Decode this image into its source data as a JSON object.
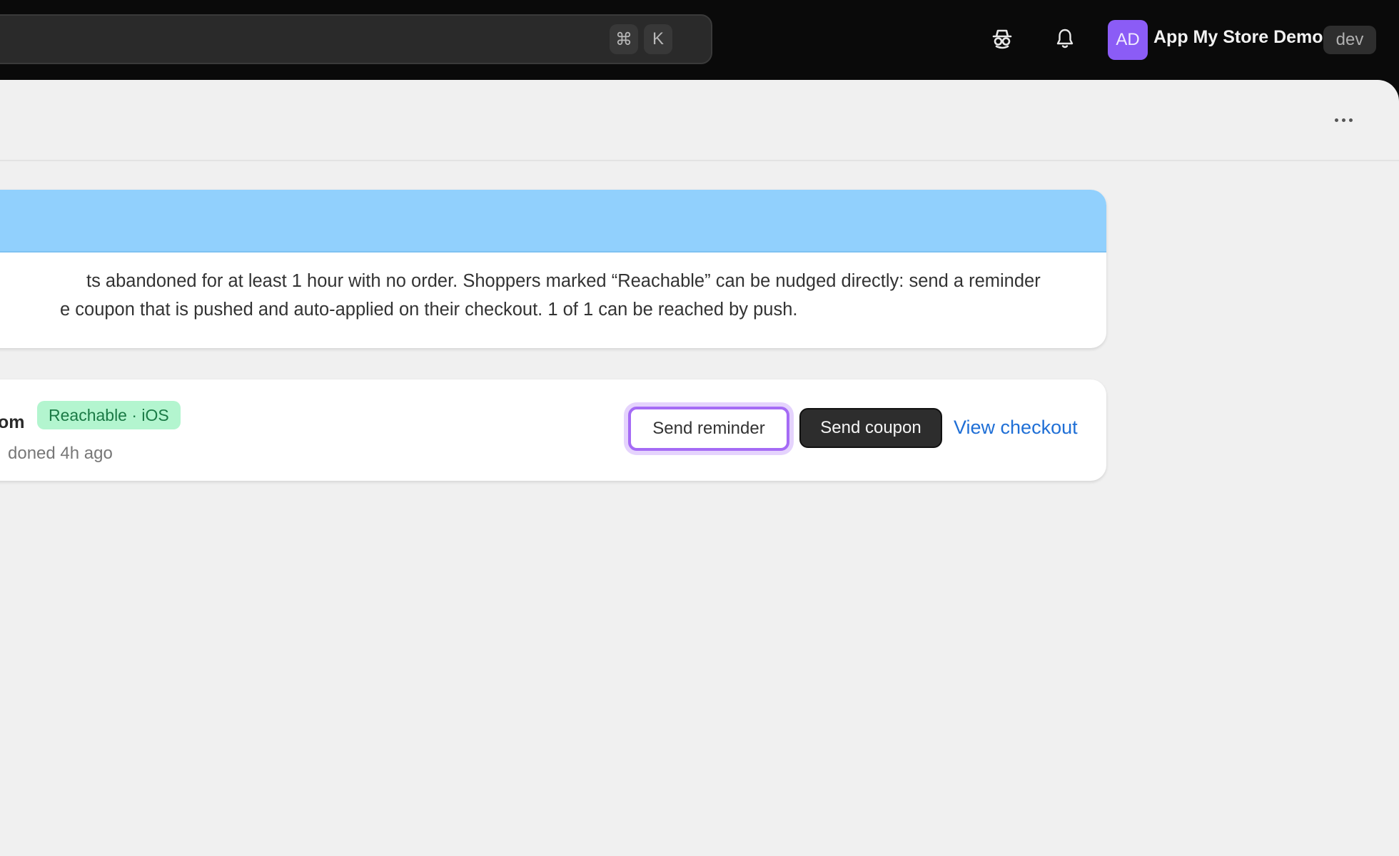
{
  "topbar": {
    "search": {
      "shortcut_mod": "⌘",
      "shortcut_key": "K"
    },
    "icons": {
      "incognito": "incognito-icon",
      "notifications": "bell-icon"
    },
    "avatar_initials": "AD",
    "app_name": "App My Store Demo",
    "environment": "dev"
  },
  "page": {
    "more_menu_icon": "more-horizontal-icon",
    "info_card": {
      "banner_color": "#91d0fd",
      "line1": "ts abandoned for at least 1 hour with no order. Shoppers marked “Reachable” can be nudged directly: send a reminder",
      "line2": "e coupon that is pushed and auto-applied on their checkout. 1 of 1 can be reached by push."
    },
    "checkout_row": {
      "name_fragment": "om",
      "badge": "Reachable · iOS",
      "subtitle": "doned 4h ago",
      "send_reminder_label": "Send reminder",
      "send_coupon_label": "Send coupon",
      "view_checkout_label": "View checkout"
    }
  },
  "colors": {
    "accent_purple": "#a56bf5",
    "link_blue": "#1f6fd6",
    "reachable_bg": "#b3f5cf",
    "reachable_text": "#1a7a45"
  }
}
